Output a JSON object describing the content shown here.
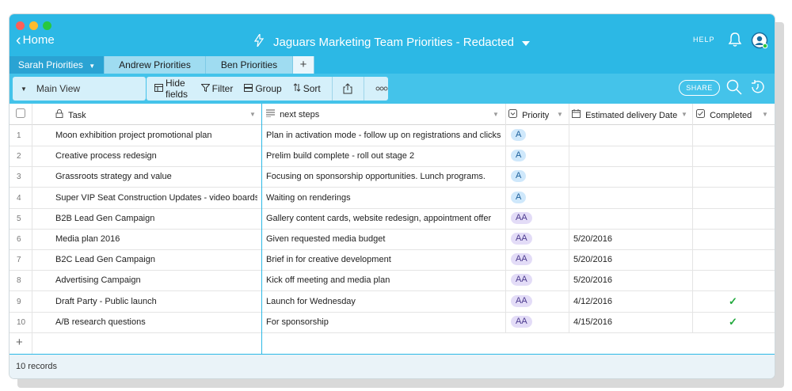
{
  "window": {
    "traffic_lights": [
      "#fe5f57",
      "#febc2e",
      "#28c840"
    ],
    "home_label": "Home",
    "title": "Jaguars Marketing Team Priorities - Redacted",
    "help_label": "HELP"
  },
  "tabs": [
    {
      "label": "Sarah Priorities",
      "active": true
    },
    {
      "label": "Andrew Priorities",
      "active": false
    },
    {
      "label": "Ben Priorities",
      "active": false
    },
    {
      "label": "+",
      "active": false
    }
  ],
  "toolbar": {
    "view_name": "Main View",
    "hide_fields": "Hide fields",
    "filter": "Filter",
    "group": "Group",
    "sort": "Sort",
    "share": "SHARE"
  },
  "columns": {
    "task": "Task",
    "next_steps": "next steps",
    "priority": "Priority",
    "delivery": "Estimated delivery Date",
    "completed": "Completed"
  },
  "rows": [
    {
      "num": "1",
      "task": "Moon exhibition project promotional plan",
      "next": "Plan in activation mode - follow up on registrations and clicks",
      "priority": "A",
      "date": "",
      "done": ""
    },
    {
      "num": "2",
      "task": "Creative process redesign",
      "next": "Prelim build complete - roll out stage 2",
      "priority": "A",
      "date": "",
      "done": ""
    },
    {
      "num": "3",
      "task": "Grassroots strategy and value",
      "next": "Focusing on sponsorship opportunities. Lunch programs.",
      "priority": "A",
      "date": "",
      "done": ""
    },
    {
      "num": "4",
      "task": "Super VIP Seat Construction Updates - video boards",
      "next": "Waiting on renderings",
      "priority": "A",
      "date": "",
      "done": ""
    },
    {
      "num": "5",
      "task": "B2B Lead Gen Campaign",
      "next": "Gallery content cards, website redesign, appointment offer",
      "priority": "AA",
      "date": "",
      "done": ""
    },
    {
      "num": "6",
      "task": "Media plan 2016",
      "next": "Given requested media budget",
      "priority": "AA",
      "date": "5/20/2016",
      "done": ""
    },
    {
      "num": "7",
      "task": "B2C Lead Gen Campaign",
      "next": "Brief in for creative development",
      "priority": "AA",
      "date": "5/20/2016",
      "done": ""
    },
    {
      "num": "8",
      "task": "Advertising Campaign",
      "next": "Kick off meeting and media plan",
      "priority": "AA",
      "date": "5/20/2016",
      "done": ""
    },
    {
      "num": "9",
      "task": "Draft Party - Public launch",
      "next": "Launch for Wednesday",
      "priority": "AA",
      "date": "4/12/2016",
      "done": "✓"
    },
    {
      "num": "10",
      "task": "A/B research questions",
      "next": "For sponsorship",
      "priority": "AA",
      "date": "4/15/2016",
      "done": "✓"
    }
  ],
  "add_row": "+",
  "footer": {
    "records": "10 records"
  },
  "colors": {
    "topbar": "#2cb8e5",
    "toolbar": "#44c3ea",
    "badge_a_bg": "#cfe8fb",
    "badge_a_fg": "#1c5f9a",
    "badge_aa_bg": "#e3dcf7",
    "badge_aa_fg": "#4b3a8e",
    "check": "#20a83c"
  }
}
